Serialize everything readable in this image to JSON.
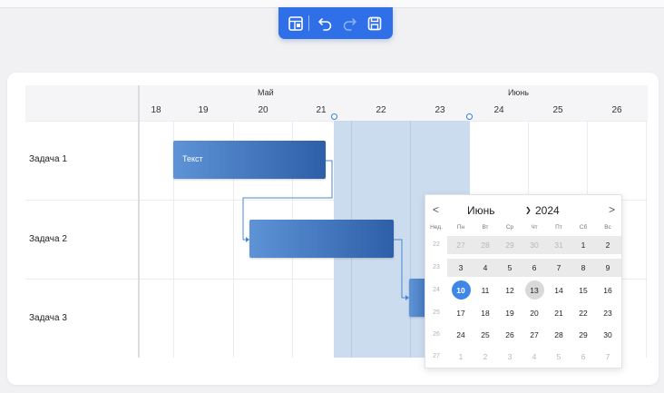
{
  "toolbar": {
    "buttons": [
      {
        "name": "calendar-grid-icon"
      },
      {
        "name": "undo-icon"
      },
      {
        "name": "redo-icon"
      },
      {
        "name": "save-icon"
      }
    ]
  },
  "timeline": {
    "months": [
      "Май",
      "Июнь"
    ],
    "days": [
      "18",
      "19",
      "20",
      "21",
      "22",
      "23",
      "24",
      "25",
      "26"
    ]
  },
  "tasks": [
    {
      "label": "Задача 1",
      "bar_text": "Текст"
    },
    {
      "label": "Задача 2",
      "bar_text": ""
    },
    {
      "label": "Задача 3",
      "bar_text": ""
    }
  ],
  "calendar": {
    "prev": "<",
    "next": ">",
    "month": "Июнь",
    "year": "2024",
    "weekday_headers": [
      "Нед.",
      "Пн",
      "Вт",
      "Ср",
      "Чт",
      "Пт",
      "Сб",
      "Вс"
    ],
    "weeks": [
      {
        "week": "22",
        "days": [
          "27",
          "28",
          "29",
          "30",
          "31",
          "1",
          "2"
        ]
      },
      {
        "week": "23",
        "days": [
          "3",
          "4",
          "5",
          "6",
          "7",
          "8",
          "9"
        ]
      },
      {
        "week": "24",
        "days": [
          "10",
          "11",
          "12",
          "13",
          "14",
          "15",
          "16"
        ]
      },
      {
        "week": "25",
        "days": [
          "17",
          "18",
          "19",
          "20",
          "21",
          "22",
          "23"
        ]
      },
      {
        "week": "26",
        "days": [
          "24",
          "25",
          "26",
          "27",
          "28",
          "29",
          "30"
        ]
      },
      {
        "week": "27",
        "days": [
          "1",
          "2",
          "3",
          "4",
          "5",
          "6",
          "7"
        ]
      }
    ],
    "selected_day": "10",
    "today_day": "13"
  }
}
